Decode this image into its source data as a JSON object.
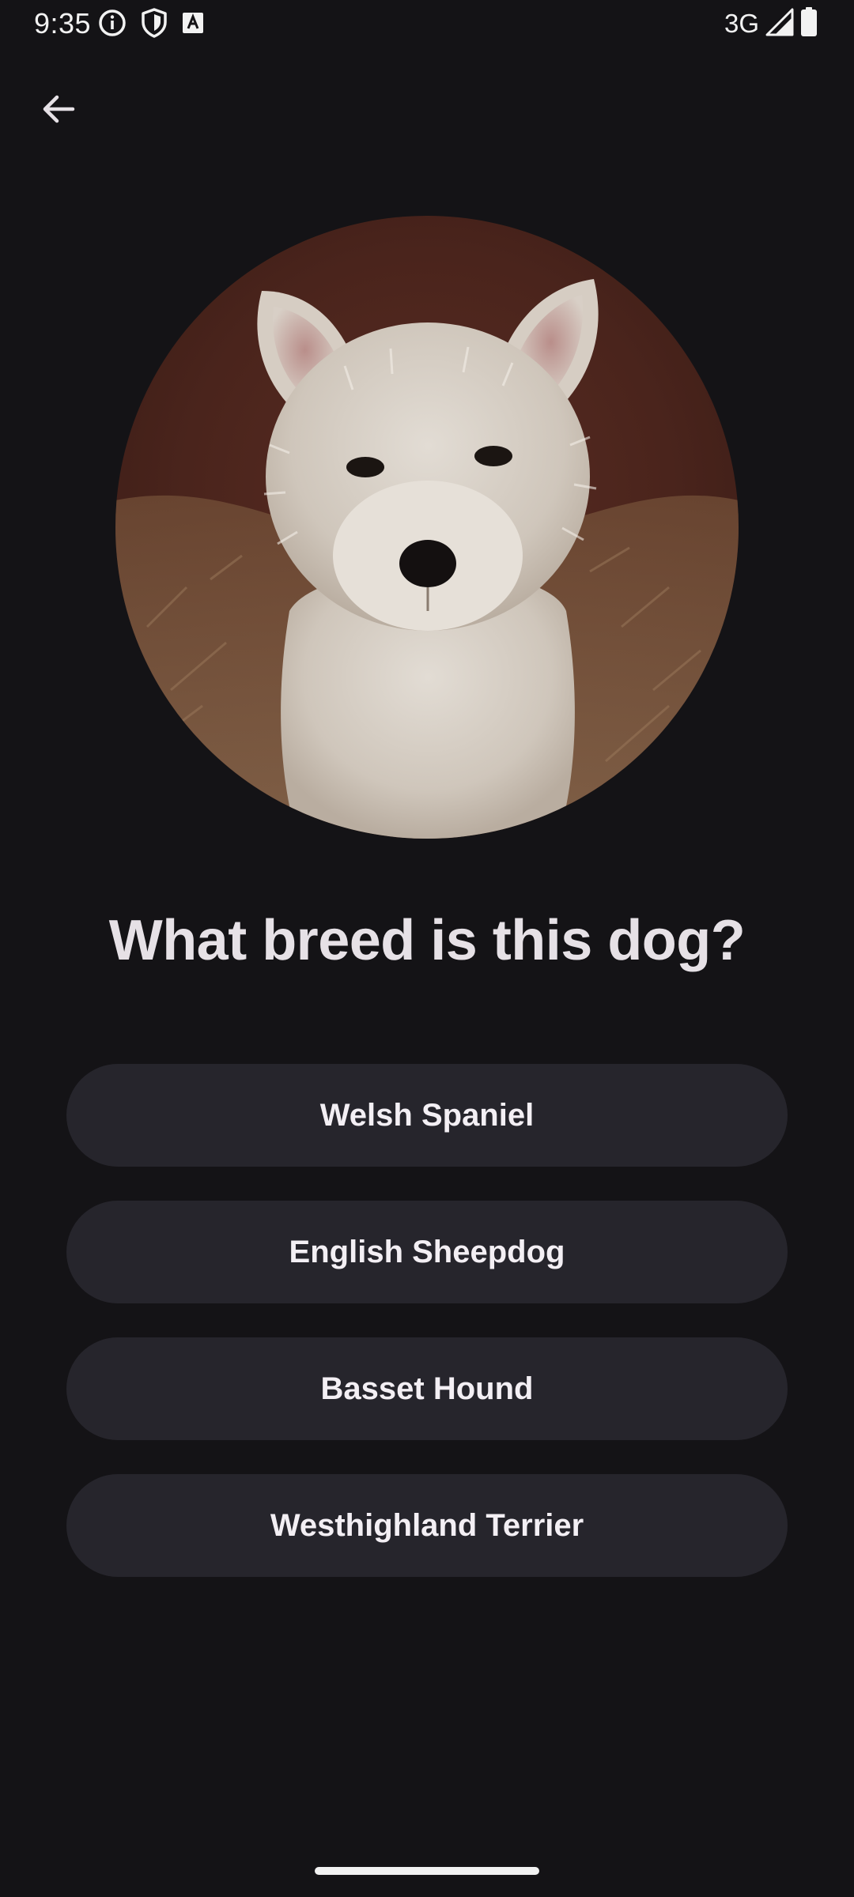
{
  "status_bar": {
    "time": "9:35",
    "network": "3G",
    "left_icons": [
      "info-icon",
      "shield-icon",
      "keyboard-a-icon"
    ],
    "right_icons": [
      "signal-icon",
      "battery-icon"
    ]
  },
  "top_bar": {
    "back_icon": "arrow-back-icon"
  },
  "quiz": {
    "image_subject": "white terrier puppy",
    "question": "What breed is this dog?",
    "answers": [
      {
        "label": "Welsh Spaniel"
      },
      {
        "label": "English Sheepdog"
      },
      {
        "label": "Basset Hound"
      },
      {
        "label": "Westhighland Terrier"
      }
    ]
  },
  "colors": {
    "background": "#141316",
    "button_background": "#26252c",
    "button_text": "#f3eff4",
    "question_text": "#e6e1e6"
  }
}
